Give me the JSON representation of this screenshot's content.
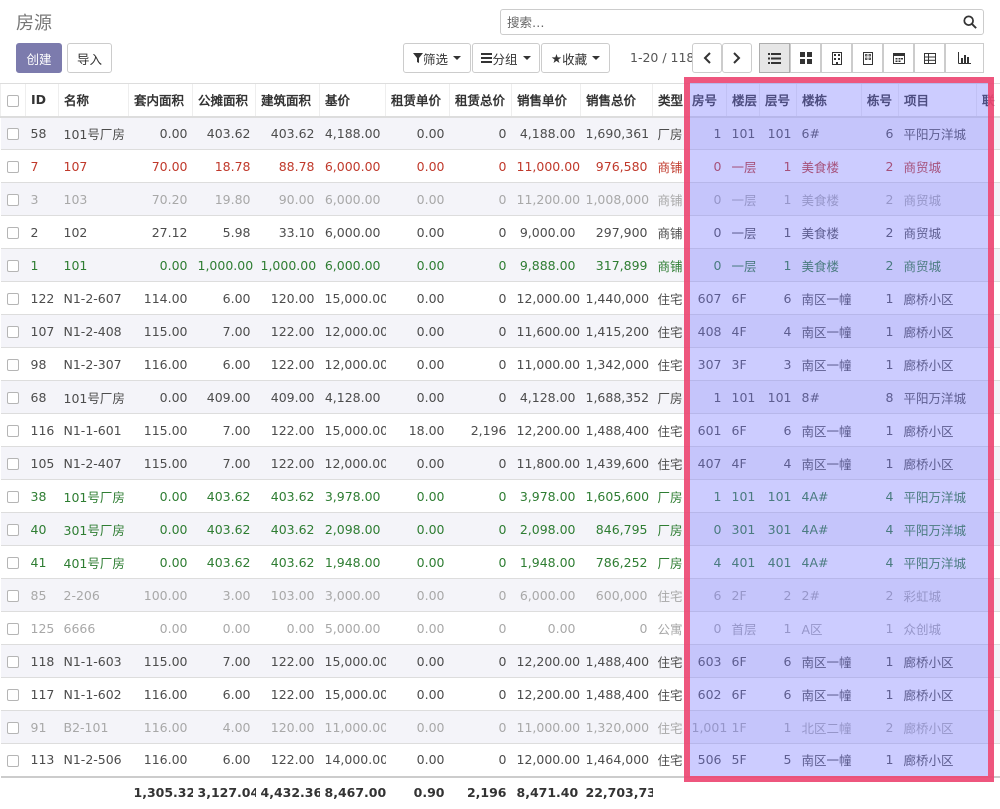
{
  "header": {
    "title": "房源",
    "search_placeholder": "搜索…",
    "create_label": "创建",
    "import_label": "导入",
    "filter_label": "筛选",
    "group_label": "分组",
    "favorite_label": "收藏",
    "pager": "1-20 / 118"
  },
  "colors": {
    "primary": "#7c7bad",
    "highlight_fill": "#7878ff",
    "highlight_border": "#f2466c",
    "red_text": "#c0392b",
    "green_text": "#2e7d32",
    "grey_text": "#a8a8a8"
  },
  "table": {
    "columns": [
      "ID",
      "名称",
      "套内面积",
      "公摊面积",
      "建筑面积",
      "基价",
      "租赁单价",
      "租赁总价",
      "销售单价",
      "销售总价",
      "类型",
      "房号",
      "楼层",
      "层号",
      "楼栋",
      "栋号",
      "项目",
      "联"
    ],
    "rows": [
      {
        "tone": "",
        "cells": [
          "58",
          "101号厂房",
          "0.00",
          "403.62",
          "403.62",
          "4,188.00",
          "0.00",
          "0",
          "4,188.00",
          "1,690,361",
          "厂房",
          "1",
          "101",
          "101",
          "6#",
          "6",
          "平阳万洋城",
          ""
        ]
      },
      {
        "tone": "red",
        "cells": [
          "7",
          "107",
          "70.00",
          "18.78",
          "88.78",
          "6,000.00",
          "0.00",
          "0",
          "11,000.00",
          "976,580",
          "商铺",
          "0",
          "一层",
          "1",
          "美食楼",
          "2",
          "商贸城",
          ""
        ]
      },
      {
        "tone": "grey",
        "cells": [
          "3",
          "103",
          "70.20",
          "19.80",
          "90.00",
          "6,000.00",
          "0.00",
          "0",
          "11,200.00",
          "1,008,000",
          "商铺",
          "0",
          "一层",
          "1",
          "美食楼",
          "2",
          "商贸城",
          ""
        ]
      },
      {
        "tone": "",
        "cells": [
          "2",
          "102",
          "27.12",
          "5.98",
          "33.10",
          "6,000.00",
          "0.00",
          "0",
          "9,000.00",
          "297,900",
          "商铺",
          "0",
          "一层",
          "1",
          "美食楼",
          "2",
          "商贸城",
          ""
        ]
      },
      {
        "tone": "green",
        "cells": [
          "1",
          "101",
          "0.00",
          "1,000.00",
          "1,000.00",
          "6,000.00",
          "0.00",
          "0",
          "9,888.00",
          "317,899",
          "商铺",
          "0",
          "一层",
          "1",
          "美食楼",
          "2",
          "商贸城",
          ""
        ]
      },
      {
        "tone": "",
        "cells": [
          "122",
          "N1-2-607",
          "114.00",
          "6.00",
          "120.00",
          "15,000.00",
          "0.00",
          "0",
          "12,000.00",
          "1,440,000",
          "住宅",
          "607",
          "6F",
          "6",
          "南区一幢",
          "1",
          "廊桥小区",
          ""
        ]
      },
      {
        "tone": "",
        "cells": [
          "107",
          "N1-2-408",
          "115.00",
          "7.00",
          "122.00",
          "12,000.00",
          "0.00",
          "0",
          "11,600.00",
          "1,415,200",
          "住宅",
          "408",
          "4F",
          "4",
          "南区一幢",
          "1",
          "廊桥小区",
          ""
        ]
      },
      {
        "tone": "",
        "cells": [
          "98",
          "N1-2-307",
          "116.00",
          "6.00",
          "122.00",
          "12,000.00",
          "0.00",
          "0",
          "11,000.00",
          "1,342,000",
          "住宅",
          "307",
          "3F",
          "3",
          "南区一幢",
          "1",
          "廊桥小区",
          ""
        ]
      },
      {
        "tone": "",
        "cells": [
          "68",
          "101号厂房",
          "0.00",
          "409.00",
          "409.00",
          "4,128.00",
          "0.00",
          "0",
          "4,128.00",
          "1,688,352",
          "厂房",
          "1",
          "101",
          "101",
          "8#",
          "8",
          "平阳万洋城",
          ""
        ]
      },
      {
        "tone": "",
        "cells": [
          "116",
          "N1-1-601",
          "115.00",
          "7.00",
          "122.00",
          "15,000.00",
          "18.00",
          "2,196",
          "12,200.00",
          "1,488,400",
          "住宅",
          "601",
          "6F",
          "6",
          "南区一幢",
          "1",
          "廊桥小区",
          ""
        ]
      },
      {
        "tone": "",
        "cells": [
          "105",
          "N1-2-407",
          "115.00",
          "7.00",
          "122.00",
          "12,000.00",
          "0.00",
          "0",
          "11,800.00",
          "1,439,600",
          "住宅",
          "407",
          "4F",
          "4",
          "南区一幢",
          "1",
          "廊桥小区",
          ""
        ]
      },
      {
        "tone": "green",
        "cells": [
          "38",
          "101号厂房",
          "0.00",
          "403.62",
          "403.62",
          "3,978.00",
          "0.00",
          "0",
          "3,978.00",
          "1,605,600",
          "厂房",
          "1",
          "101",
          "101",
          "4A#",
          "4",
          "平阳万洋城",
          ""
        ]
      },
      {
        "tone": "green",
        "cells": [
          "40",
          "301号厂房",
          "0.00",
          "403.62",
          "403.62",
          "2,098.00",
          "0.00",
          "0",
          "2,098.00",
          "846,795",
          "厂房",
          "0",
          "301",
          "301",
          "4A#",
          "4",
          "平阳万洋城",
          ""
        ]
      },
      {
        "tone": "green",
        "cells": [
          "41",
          "401号厂房",
          "0.00",
          "403.62",
          "403.62",
          "1,948.00",
          "0.00",
          "0",
          "1,948.00",
          "786,252",
          "厂房",
          "4",
          "401",
          "401",
          "4A#",
          "4",
          "平阳万洋城",
          ""
        ]
      },
      {
        "tone": "grey",
        "cells": [
          "85",
          "2-206",
          "100.00",
          "3.00",
          "103.00",
          "3,000.00",
          "0.00",
          "0",
          "6,000.00",
          "600,000",
          "住宅",
          "6",
          "2F",
          "2",
          "2#",
          "2",
          "彩虹城",
          ""
        ]
      },
      {
        "tone": "grey",
        "cells": [
          "125",
          "6666",
          "0.00",
          "0.00",
          "0.00",
          "5,000.00",
          "0.00",
          "0",
          "0.00",
          "0",
          "公寓",
          "0",
          "首层",
          "1",
          "A区",
          "1",
          "众创城",
          ""
        ]
      },
      {
        "tone": "",
        "cells": [
          "118",
          "N1-1-603",
          "115.00",
          "7.00",
          "122.00",
          "15,000.00",
          "0.00",
          "0",
          "12,200.00",
          "1,488,400",
          "住宅",
          "603",
          "6F",
          "6",
          "南区一幢",
          "1",
          "廊桥小区",
          ""
        ]
      },
      {
        "tone": "",
        "cells": [
          "117",
          "N1-1-602",
          "116.00",
          "6.00",
          "122.00",
          "15,000.00",
          "0.00",
          "0",
          "12,200.00",
          "1,488,400",
          "住宅",
          "602",
          "6F",
          "6",
          "南区一幢",
          "1",
          "廊桥小区",
          ""
        ]
      },
      {
        "tone": "grey",
        "cells": [
          "91",
          "B2-101",
          "116.00",
          "4.00",
          "120.00",
          "11,000.00",
          "0.00",
          "0",
          "11,000.00",
          "1,320,000",
          "住宅",
          "1,001",
          "1F",
          "1",
          "北区二幢",
          "2",
          "廊桥小区",
          ""
        ]
      },
      {
        "tone": "",
        "cells": [
          "113",
          "N1-2-506",
          "116.00",
          "6.00",
          "122.00",
          "14,000.00",
          "0.00",
          "0",
          "12,000.00",
          "1,464,000",
          "住宅",
          "506",
          "5F",
          "5",
          "南区一幢",
          "1",
          "廊桥小区",
          ""
        ]
      }
    ],
    "totals": [
      "",
      "",
      "1,305.32",
      "3,127.04",
      "4,432.36",
      "8,467.00",
      "0.90",
      "2,196",
      "8,471.40",
      "22,703,739",
      "",
      "",
      "",
      "",
      "",
      "",
      "",
      ""
    ]
  }
}
